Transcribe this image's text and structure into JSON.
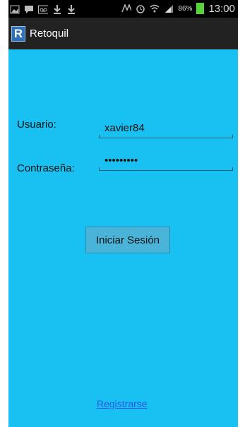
{
  "status_bar": {
    "icons": [
      "image-icon",
      "chat-icon",
      "voicemail-icon",
      "download-icon",
      "download-icon",
      "nfc-icon",
      "alarm-icon",
      "wifi-icon",
      "signal-icon"
    ],
    "battery_percent": "86%",
    "time": "13:00",
    "battery_color": "#58d43b"
  },
  "app_bar": {
    "app_initial": "R",
    "title": "Retoquil"
  },
  "form": {
    "username_label": "Usuario:",
    "username_value": "xavier84",
    "password_label": "Contraseña:",
    "password_value": "•••••••••",
    "login_button": "Iniciar Sesión",
    "register_link": "Registrarse"
  },
  "colors": {
    "background": "#18c1f1",
    "link": "#2b5bdc",
    "action_bar": "#222222"
  }
}
